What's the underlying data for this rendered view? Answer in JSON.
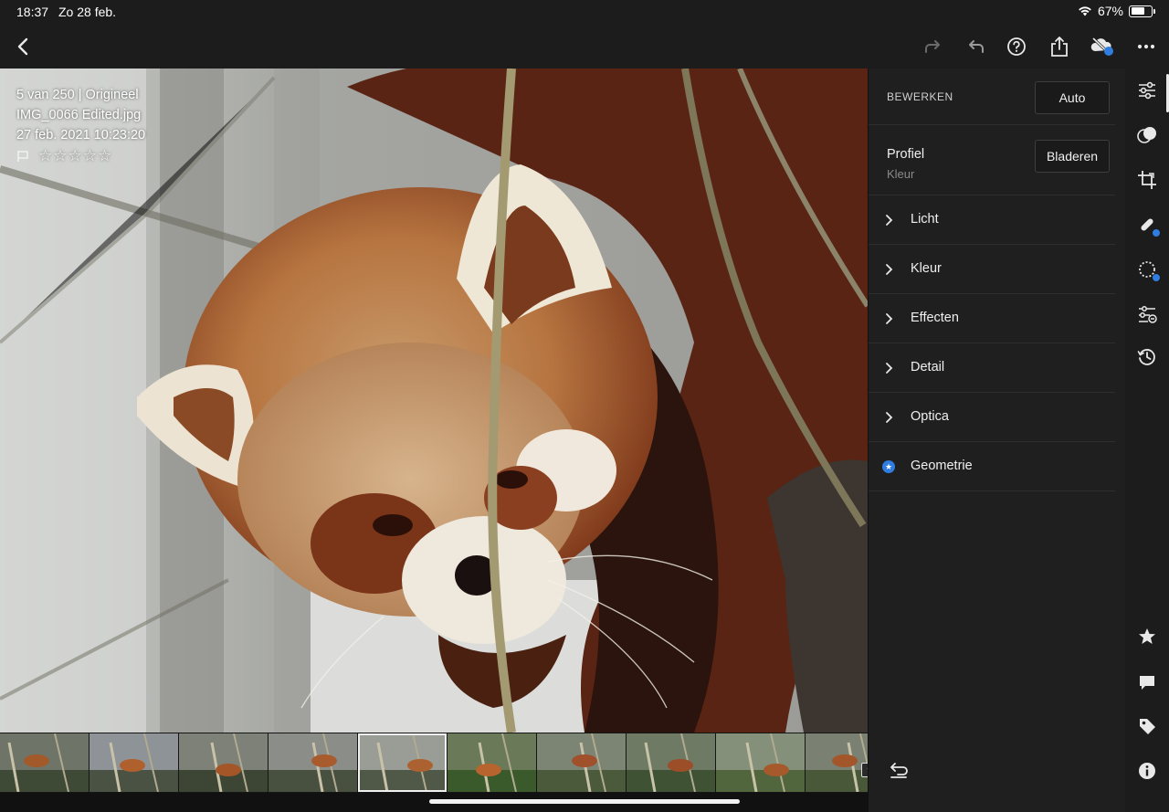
{
  "status": {
    "time": "18:37",
    "date": "Zo 28 feb.",
    "battery": "67%",
    "battery_level": 0.67
  },
  "photo": {
    "position": "5 van 250 | Origineel",
    "filename": "IMG_0066 Edited.jpg",
    "datetime": "27 feb. 2021 10:23:20",
    "stars": "☆☆☆☆☆",
    "rating": 0
  },
  "panel": {
    "title": "BEWERKEN",
    "auto_label": "Auto",
    "profile_label": "Profiel",
    "profile_value": "Kleur",
    "browse_label": "Bladeren",
    "sections": [
      {
        "label": "Licht"
      },
      {
        "label": "Kleur"
      },
      {
        "label": "Effecten"
      },
      {
        "label": "Detail"
      },
      {
        "label": "Optica"
      },
      {
        "label": "Geometrie"
      }
    ]
  },
  "filmstrip": {
    "count": 10,
    "selected_index": 4
  },
  "colors": {
    "accent": "#2f7de1",
    "panel_bg": "#1f1f1f",
    "toolbar_bg": "#1c1c1c"
  },
  "icons": {
    "toolbar": [
      "back-icon",
      "redo-icon",
      "undo-icon",
      "help-icon",
      "share-icon",
      "cloud-sync-icon",
      "more-icon"
    ],
    "rail": [
      "edit-sliders-icon",
      "presets-icon",
      "crop-icon",
      "healing-icon",
      "masking-icon",
      "selective-icon",
      "history-icon",
      "star-icon",
      "comment-icon",
      "tag-icon",
      "info-icon"
    ]
  }
}
